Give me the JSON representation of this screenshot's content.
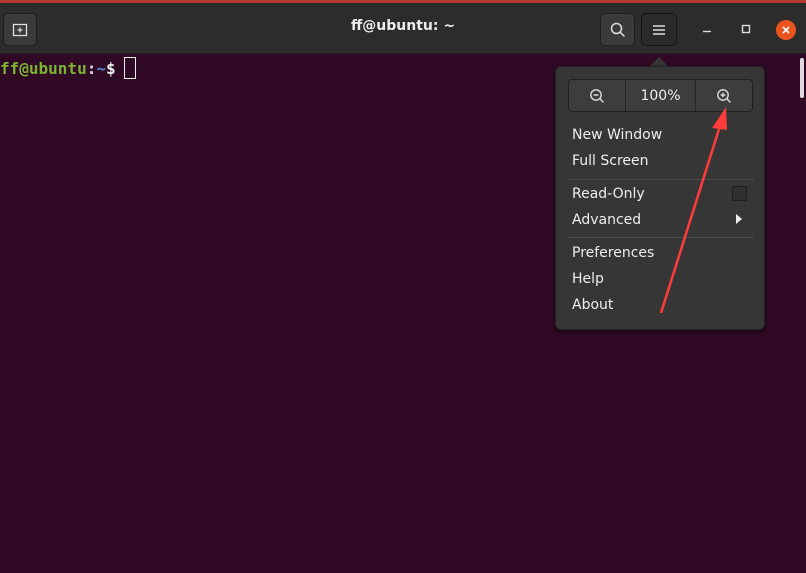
{
  "window": {
    "title": "ff@ubuntu: ~"
  },
  "terminal": {
    "prompt_user": "ff@ubuntu",
    "prompt_colon": ":",
    "prompt_path": "~",
    "prompt_dollar": "$"
  },
  "menu": {
    "zoom_level": "100%",
    "items": [
      {
        "label": "New Window"
      },
      {
        "label": "Full Screen"
      },
      {
        "label": "Read-Only"
      },
      {
        "label": "Advanced"
      },
      {
        "label": "Preferences"
      },
      {
        "label": "Help"
      },
      {
        "label": "About"
      }
    ],
    "read_only_checked": false
  },
  "icons": {
    "new_tab": "new-tab-icon",
    "search": "search-icon",
    "menu": "hamburger-menu-icon",
    "minimize": "minimize-icon",
    "maximize": "maximize-icon",
    "close": "close-icon",
    "zoom_out": "zoom-out-icon",
    "zoom_in": "zoom-in-icon",
    "submenu": "chevron-right-icon"
  },
  "colors": {
    "terminal_bg": "#300a24",
    "titlebar_bg": "#2c2c2c",
    "prompt_user": "#7bb333",
    "prompt_path": "#4e8bd6",
    "close_button": "#e9541f",
    "annotation_arrow": "#ff3b3b"
  }
}
